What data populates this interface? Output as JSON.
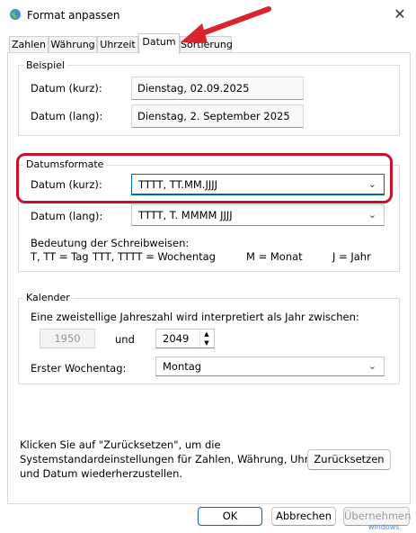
{
  "window": {
    "title": "Format anpassen",
    "close_symbol": "✕"
  },
  "tabs": [
    "Zahlen",
    "Währung",
    "Uhrzeit",
    "Datum",
    "Sortierung"
  ],
  "active_tab": "Datum",
  "beispiel": {
    "legend": "Beispiel",
    "kurz_label": "Datum (kurz):",
    "kurz_value": "Dienstag, 02.09.2025",
    "lang_label": "Datum (lang):",
    "lang_value": "Dienstag, 2. September 2025"
  },
  "datumsformate": {
    "legend": "Datumsformate",
    "kurz_label": "Datum (kurz):",
    "kurz_value": "TTTT, TT.MM.JJJJ",
    "lang_label": "Datum (lang):",
    "lang_value": "TTTT, T. MMMM JJJJ",
    "bedeutung_title": "Bedeutung der Schreibweisen:",
    "bedeutung_items": [
      "T, TT = Tag",
      "TTT, TTTT = Wochentag",
      "M = Monat",
      "J = Jahr"
    ]
  },
  "kalender": {
    "legend": "Kalender",
    "twodigit_text": "Eine zweistellige Jahreszahl wird interpretiert als Jahr zwischen:",
    "from_year": "1950",
    "und_label": "und",
    "to_year": "2049",
    "erster_label": "Erster Wochentag:",
    "erster_value": "Montag"
  },
  "reset": {
    "text_line1": "Klicken Sie auf \"Zurücksetzen\", um die",
    "text_line2": "Systemstandardeinstellungen für Zahlen, Währung, Uhrzeit",
    "text_line3": "und Datum wiederherzustellen.",
    "button": "Zurücksetzen"
  },
  "footer": {
    "ok": "OK",
    "cancel": "Abbrechen",
    "apply": "Übernehmen"
  },
  "watermark": "windows",
  "colors": {
    "highlight": "#c8102e",
    "accent": "#0067c0"
  }
}
